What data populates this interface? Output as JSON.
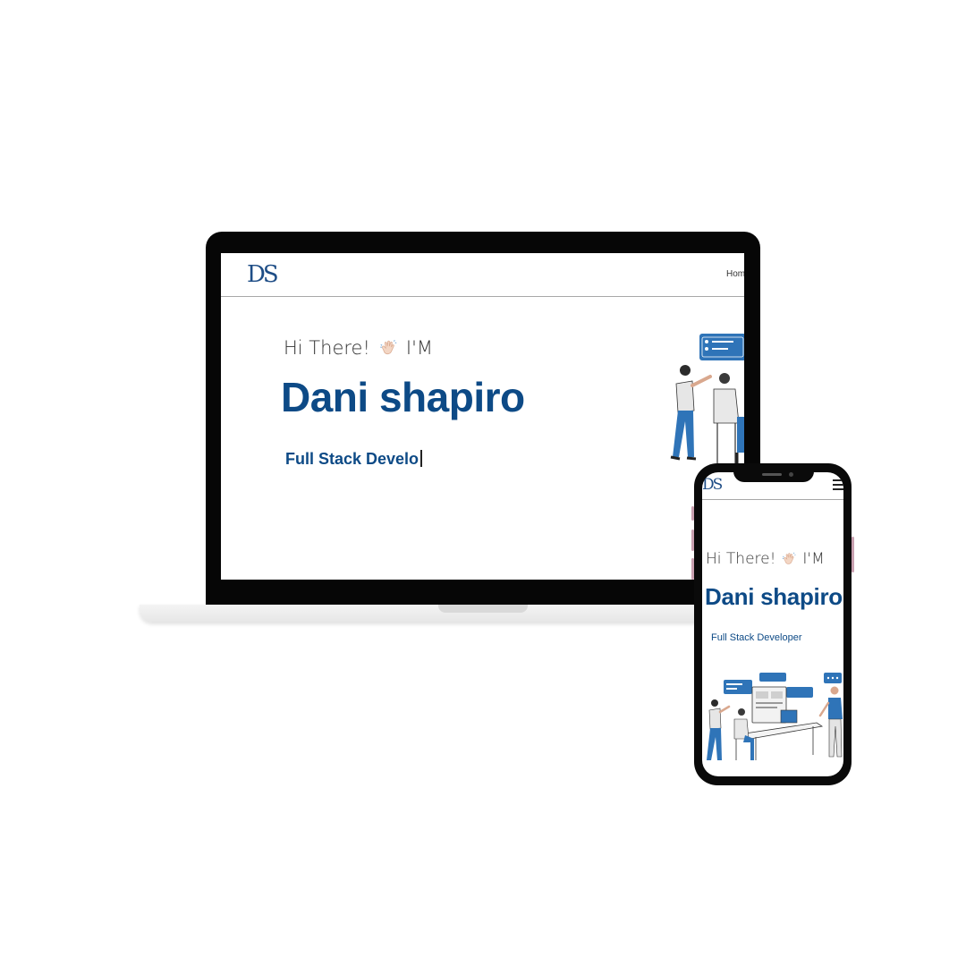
{
  "laptop": {
    "logo": "DS",
    "nav": {
      "home_label": "Hom"
    },
    "hero": {
      "greeting_before": "Hi There!",
      "greeting_after": "I'M",
      "name": "Dani shapiro",
      "role_typed": "Full Stack Develo"
    }
  },
  "phone": {
    "logo": "DS",
    "hero": {
      "greeting_before": "Hi There!",
      "greeting_after": "I'M",
      "name": "Dani shapiro",
      "role": "Full Stack Developer"
    }
  },
  "icons": {
    "wave": "waving-hand-icon",
    "menu": "hamburger-menu-icon"
  },
  "colors": {
    "brand_blue": "#0d4a86",
    "accent_blue": "#2f74b8",
    "frame": "#060606"
  }
}
